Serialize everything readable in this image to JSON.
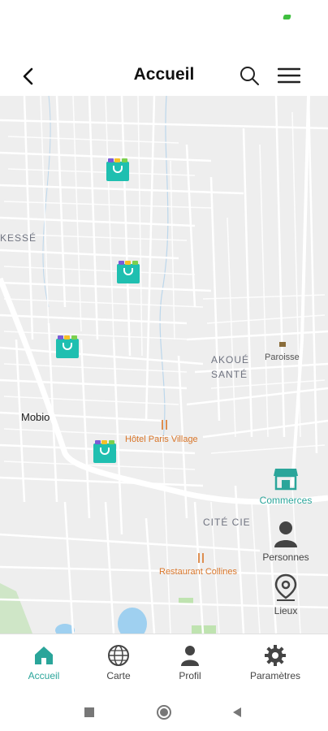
{
  "header": {
    "title": "Accueil",
    "back_icon": "chevron-left-icon",
    "search_icon": "search-icon",
    "menu_icon": "hamburger-menu-icon"
  },
  "map": {
    "labels": {
      "kesse": "KESSÉ",
      "akoue_line1": "AKOUÉ",
      "akoue_line2": "SANTÉ",
      "mobio": "Mobio",
      "paroisse": "Paroisse",
      "hotel": "Hôtel Paris Village",
      "cite": "CITÉ CIE",
      "restaurant": "Restaurant Collines"
    },
    "marker_count": 4
  },
  "side_filters": {
    "commerces": "Commerces",
    "personnes": "Personnes",
    "lieux": "Lieux"
  },
  "bottom_nav": {
    "items": [
      {
        "label": "Accueil",
        "icon": "home-icon",
        "active": true
      },
      {
        "label": "Carte",
        "icon": "globe-icon",
        "active": false
      },
      {
        "label": "Profil",
        "icon": "user-icon",
        "active": false
      },
      {
        "label": "Paramètres",
        "icon": "gear-icon",
        "active": false
      }
    ]
  },
  "colors": {
    "accent": "#2aa59a",
    "marker": "#1fbfb0",
    "poi": "#d9762a",
    "map_bg": "#eeeeee"
  }
}
